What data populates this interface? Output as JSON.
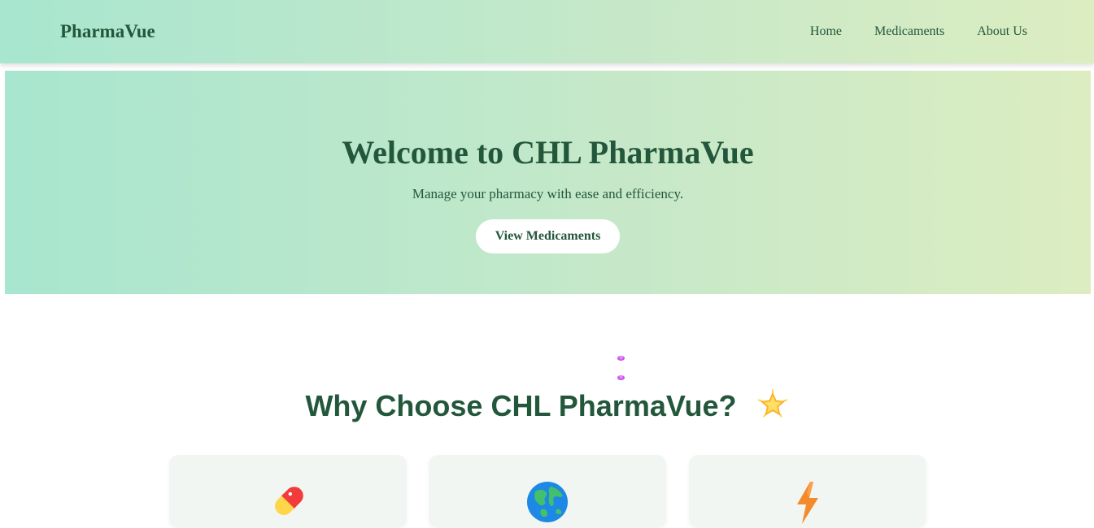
{
  "navbar": {
    "brand": "PharmaVue",
    "links": [
      "Home",
      "Medicaments",
      "About Us"
    ]
  },
  "hero": {
    "title": "Welcome to CHL PharmaVue",
    "subtitle": "Manage your pharmacy with ease and efficiency.",
    "button_label": "View Medicaments"
  },
  "features": {
    "title": "Why Choose CHL PharmaVue?",
    "title_icon": "star-icon",
    "cards": [
      {
        "icon": "pill-icon"
      },
      {
        "icon": "globe-icon"
      },
      {
        "icon": "lightning-icon"
      }
    ]
  },
  "colors": {
    "primary_text": "#23573c",
    "gradient_start": "#a8e6cf",
    "gradient_end": "#dcedc1",
    "card_background": "#f2f6f3"
  }
}
